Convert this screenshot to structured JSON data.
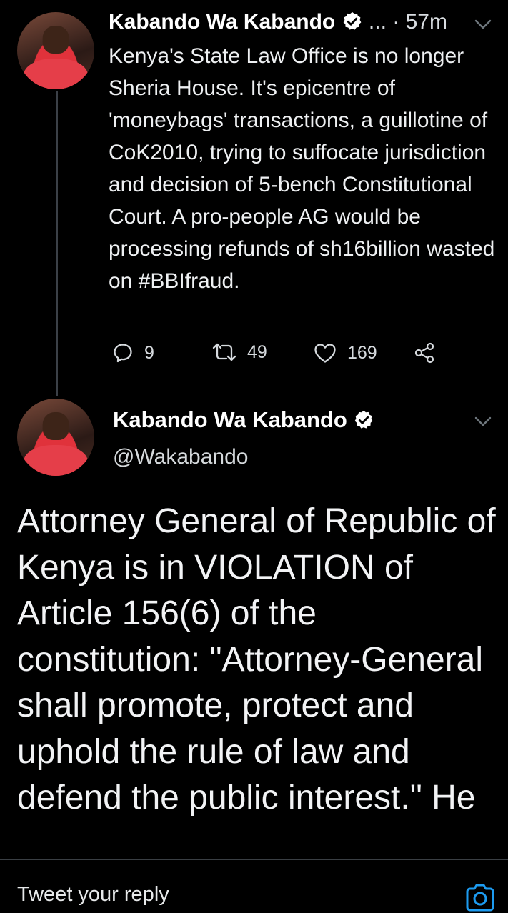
{
  "tweet1": {
    "name": "Kabando Wa Kabando",
    "ellipsis": "...",
    "time": "· 57m",
    "text": "Kenya's State Law Office is no longer Sheria House. It's epicentre of 'moneybags' transactions, a guillotine of CoK2010, trying to suffocate jurisdiction and decision of 5-bench Constitutional Court. A pro-people AG would be processing refunds of sh16billion wasted on #BBIfraud.",
    "replies": "9",
    "retweets": "49",
    "likes": "169"
  },
  "tweet2": {
    "name": "Kabando Wa Kabando",
    "handle": "@Wakabando",
    "text": "Attorney General of Republic of Kenya is in VIOLATION of Article 156(6) of the constitution: \"Attorney-General shall promote, protect and uphold the rule of law and defend the public interest.\"  He"
  },
  "reply": {
    "placeholder": "Tweet your reply"
  },
  "icons": {
    "verified": "verified-badge-icon",
    "chevron": "chevron-down-icon",
    "reply": "reply-icon",
    "retweet": "retweet-icon",
    "like": "heart-icon",
    "share": "share-icon",
    "camera": "camera-icon"
  },
  "colors": {
    "background": "#000000",
    "accent": "#1d9bf0",
    "thread_line": "#3b4047"
  }
}
